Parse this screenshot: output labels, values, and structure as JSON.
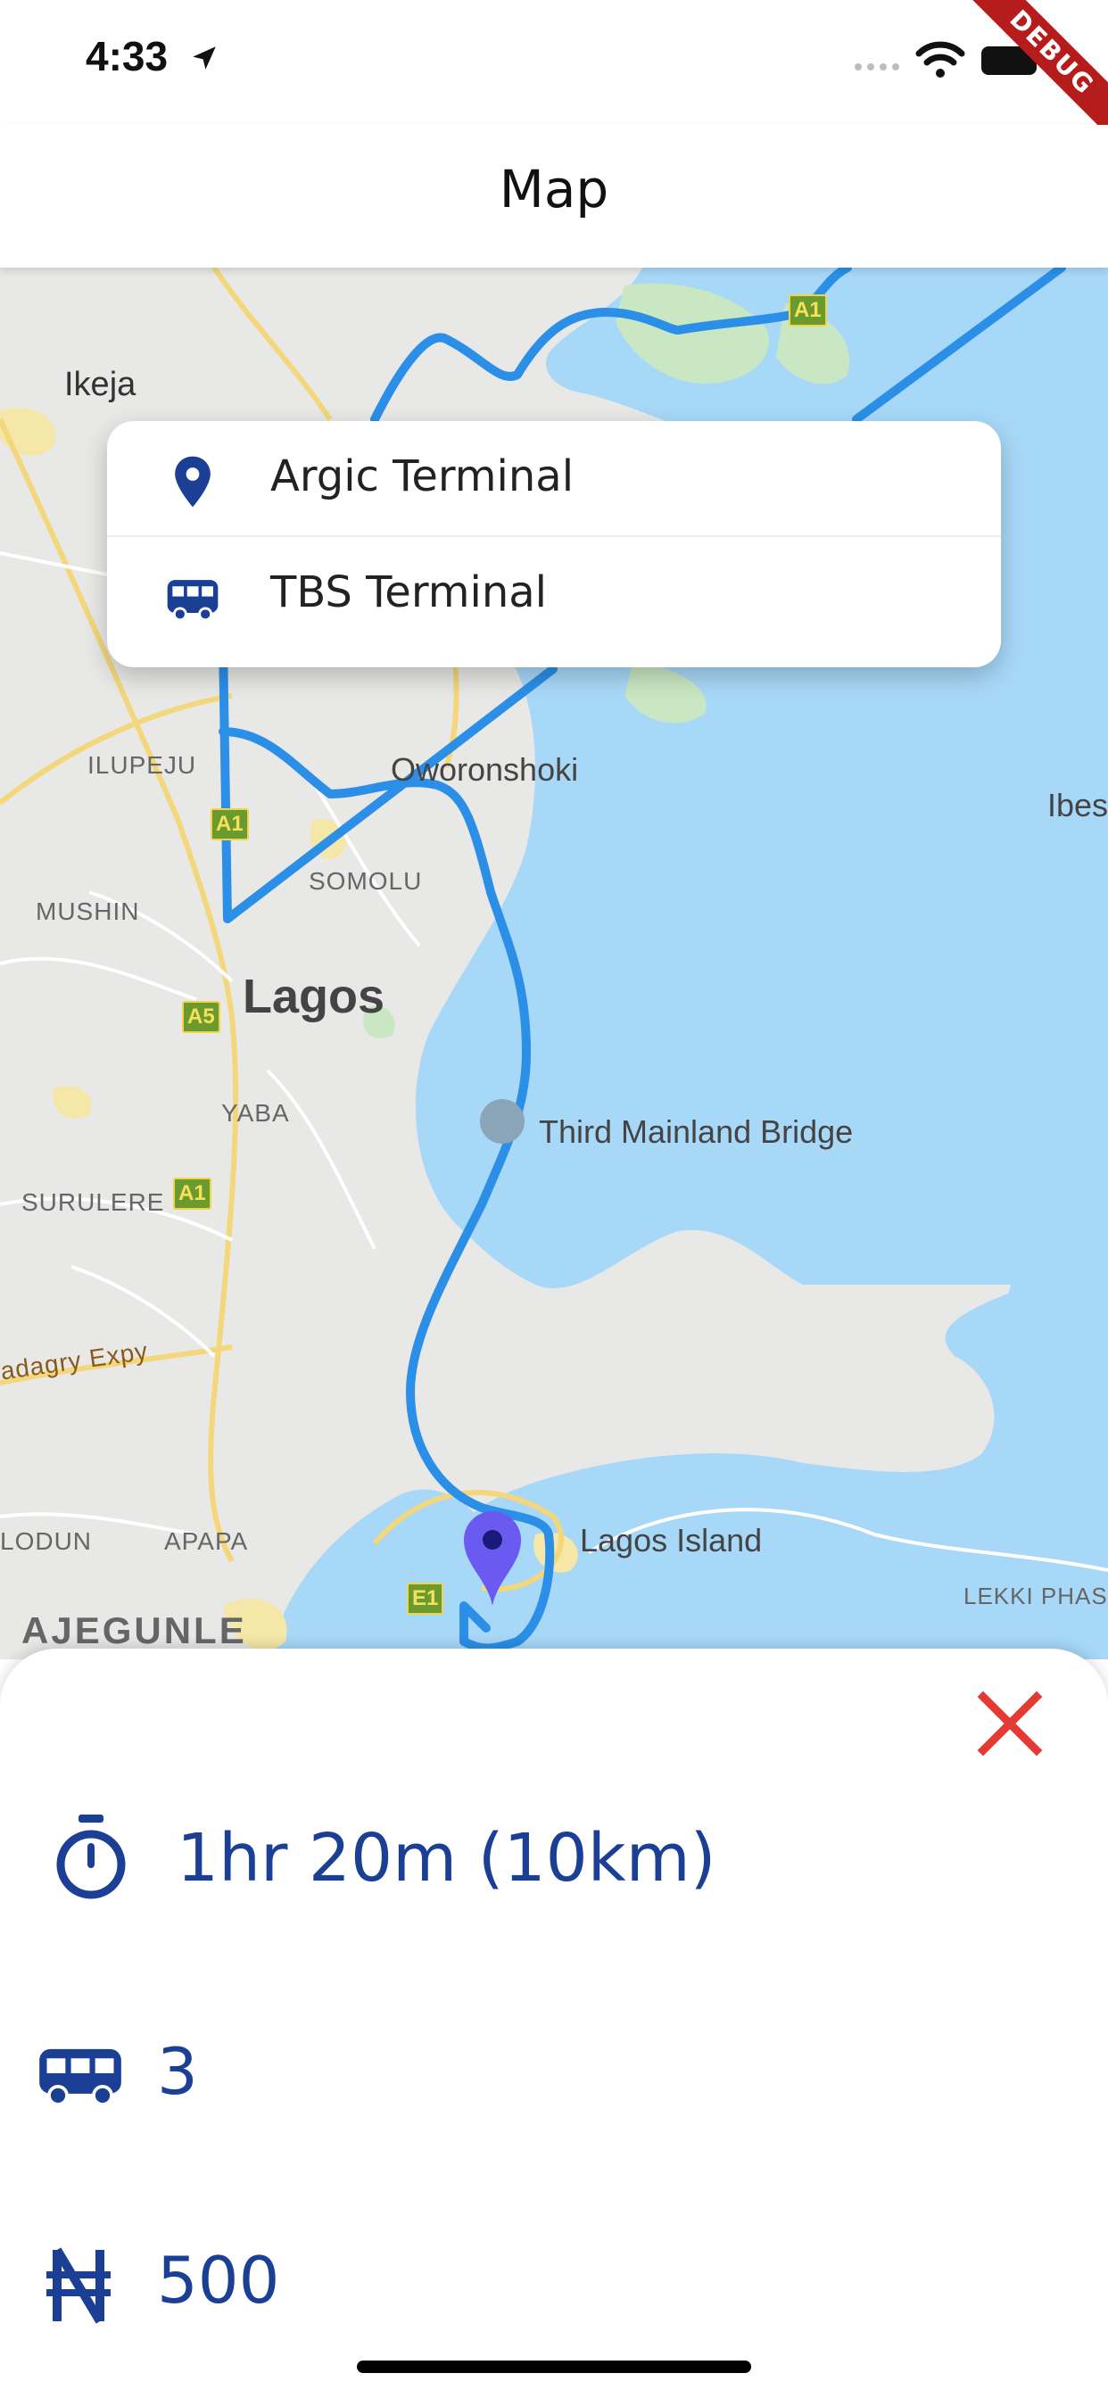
{
  "status_bar": {
    "time": "4:33"
  },
  "debug_banner": {
    "label": "DEBUG"
  },
  "app_bar": {
    "title": "Map"
  },
  "search": {
    "from": {
      "label": "Argic Terminal",
      "icon": "location-pin-icon"
    },
    "to": {
      "label": "TBS Terminal",
      "icon": "bus-icon"
    }
  },
  "map": {
    "labels": {
      "ikeja": "Ikeja",
      "ilupeju": "ILUPEJU",
      "oworonshoki": "Oworonshoki",
      "ibes": "Ibes",
      "somolu": "SOMOLU",
      "mushin": "MUSHIN",
      "lagos": "Lagos",
      "yaba": "YABA",
      "third_mainland_bridge": "Third Mainland Bridge",
      "surulere": "SURULERE",
      "badagry_expy": "adagry Expy",
      "lodun": "LODUN",
      "apapa": "APAPA",
      "lagos_island": "Lagos Island",
      "lekki_phase": "LEKKI PHASE",
      "ajegunle": "AJEGUNLE"
    },
    "road_shields": {
      "a1_top": "A1",
      "a1_mid": "A1",
      "a5": "A5",
      "a1_low": "A1",
      "e1": "E1"
    },
    "colors": {
      "water": "#a8d8f8",
      "land": "#e8e8e6",
      "route": "#2b8fe8",
      "marker": "#6a5af0"
    }
  },
  "trip": {
    "duration": "1hr 20m (10km)",
    "buses": "3",
    "fare": "500",
    "icons": {
      "duration": "timer-icon",
      "buses": "bus-icon",
      "fare": "naira-icon",
      "close": "close-icon"
    }
  },
  "colors": {
    "accent": "#1a3f95",
    "close": "#e53935"
  }
}
